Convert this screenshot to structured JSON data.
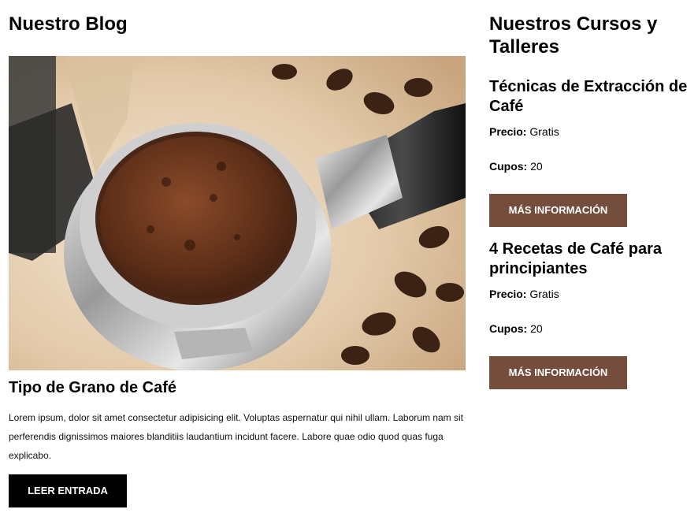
{
  "blog": {
    "heading": "Nuestro Blog",
    "post": {
      "title": "Tipo de Grano de Café",
      "excerpt": "Lorem ipsum, dolor sit amet consectetur adipisicing elit. Voluptas aspernatur qui nihil ullam. Laborum nam sit perferendis dignissimos maiores blanditiis laudantium incidunt facere. Labore quae odio quod quas fuga explicabo.",
      "button_label": "LEER ENTRADA",
      "image_icon": "coffee-portafilter-photo"
    }
  },
  "courses": {
    "heading": "Nuestros Cursos y Talleres",
    "price_label": "Precio:",
    "slots_label": "Cupos:",
    "items": [
      {
        "title": "Técnicas de Extracción de Café",
        "price": "Gratis",
        "slots": "20",
        "button_label": "MÁS INFORMACIÓN"
      },
      {
        "title": "4 Recetas de Café para principiantes",
        "price": "Gratis",
        "slots": "20",
        "button_label": "MÁS INFORMACIÓN"
      }
    ]
  },
  "colors": {
    "brown_button": "#744d3c",
    "black_button": "#000000"
  }
}
